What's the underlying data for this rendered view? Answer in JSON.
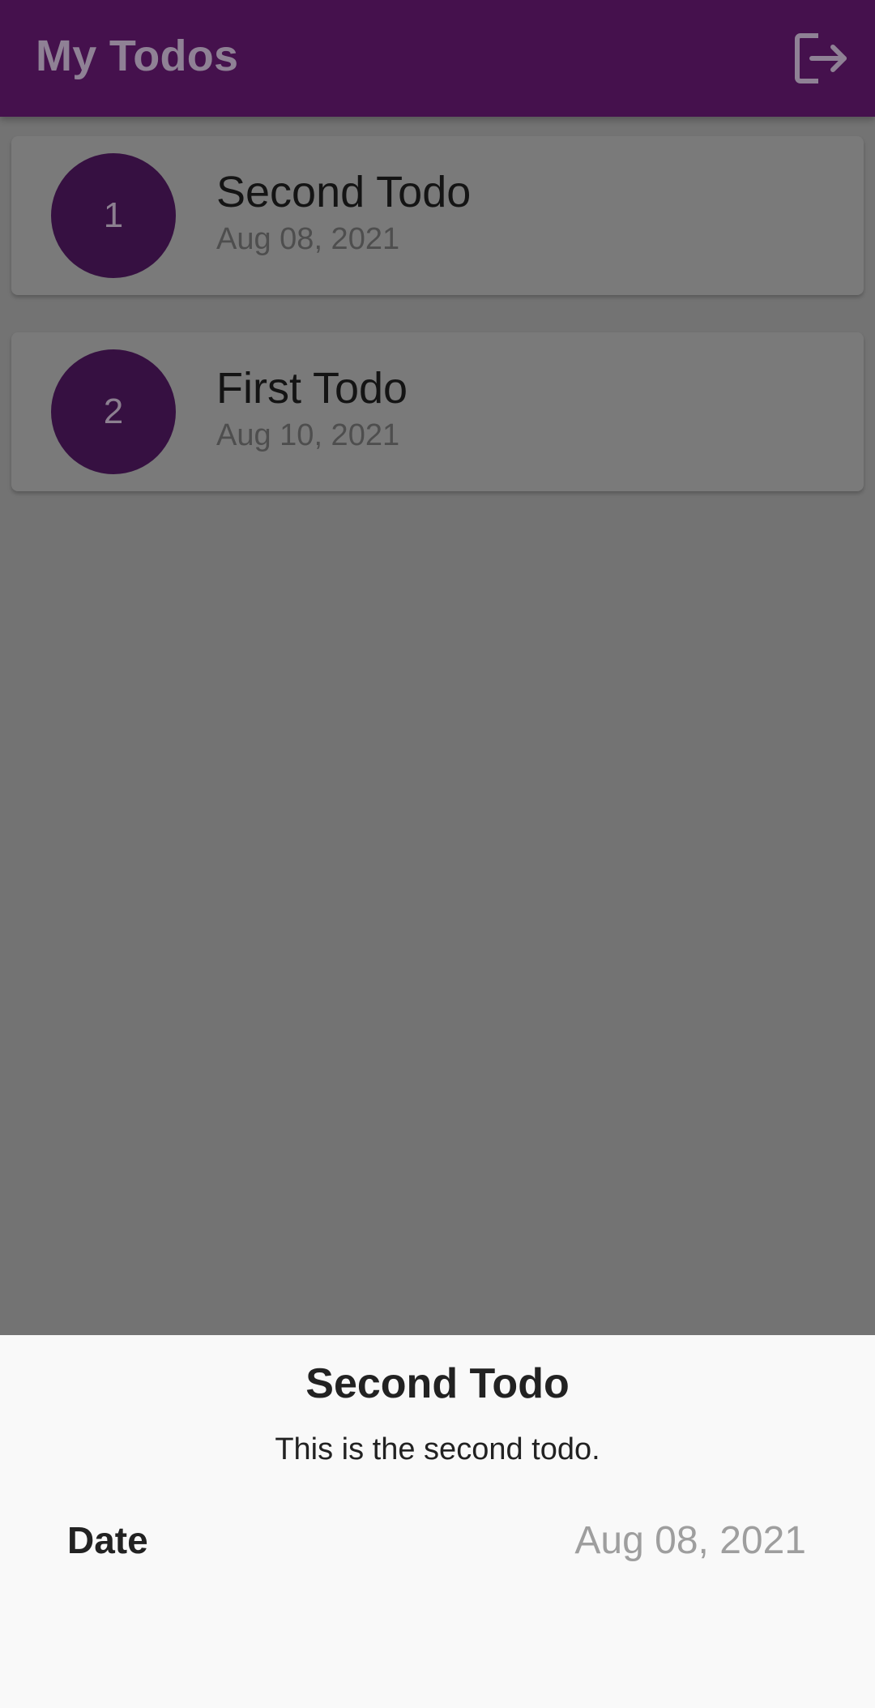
{
  "appbar": {
    "title": "My Todos",
    "logout_icon": "logout-icon",
    "color": "#45114d"
  },
  "todos": [
    {
      "number": "1",
      "title": "Second Todo",
      "date": "Aug 08, 2021"
    },
    {
      "number": "2",
      "title": "First Todo",
      "date": "Aug 10, 2021"
    }
  ],
  "sheet": {
    "title": "Second Todo",
    "description": "This is the second todo.",
    "date_label": "Date",
    "date_value": "Aug 08, 2021"
  },
  "colors": {
    "accent": "#361041",
    "scrim": "#737373",
    "sheet_background": "#f9f9f9"
  }
}
